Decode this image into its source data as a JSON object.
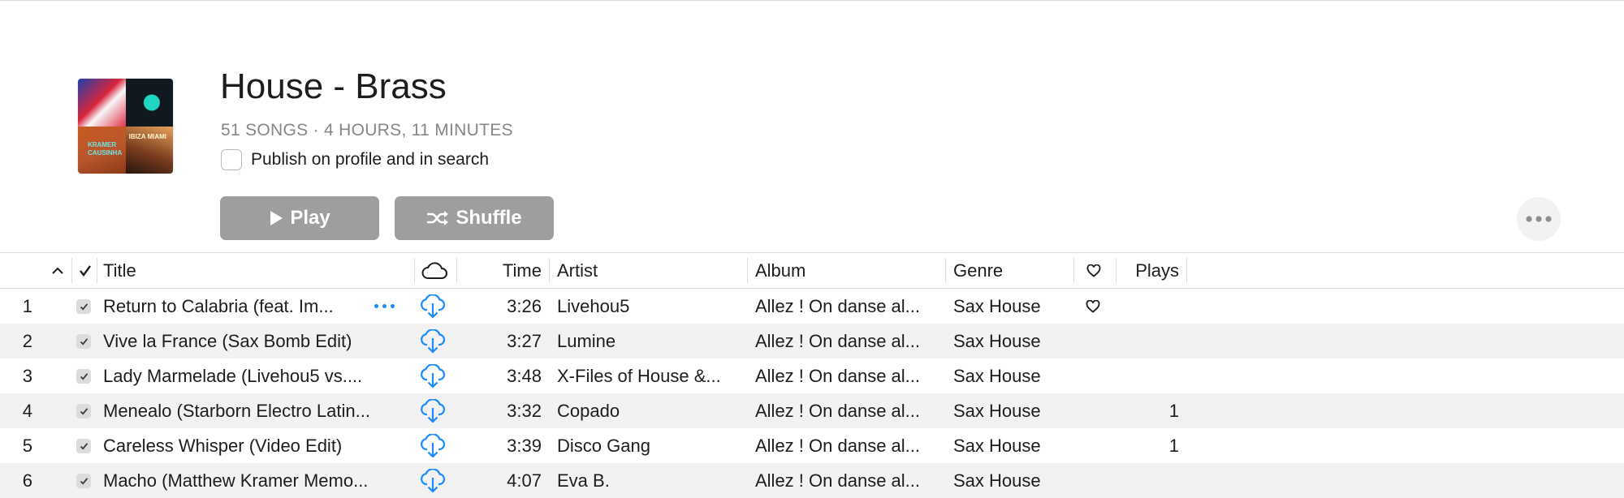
{
  "playlist": {
    "title": "House - Brass",
    "subtitle": "51 SONGS · 4 HOURS, 11 MINUTES",
    "publish_label": "Publish on profile and in search",
    "publish_checked": false,
    "artwork_text": {
      "tile3": "KRAMER CAUSINHA",
      "tile4": "IBIZA MIAMI"
    }
  },
  "buttons": {
    "play_label": "Play",
    "shuffle_label": "Shuffle",
    "color": "#9e9e9e"
  },
  "columns": {
    "sort_indicator": "^",
    "check": "✓",
    "title": "Title",
    "cloud_icon": "cloud-icon",
    "time": "Time",
    "artist": "Artist",
    "album": "Album",
    "genre": "Genre",
    "love_icon": "heart-icon",
    "plays": "Plays"
  },
  "accent_color": "#1a8cff",
  "rows": [
    {
      "num": "1",
      "title": "Return to Calabria (feat. Im...",
      "time": "3:26",
      "artist": "Livehou5",
      "album": "Allez ! On danse al...",
      "genre": "Sax House",
      "loved": true,
      "plays": ""
    },
    {
      "num": "2",
      "title": "Vive la France (Sax Bomb Edit)",
      "time": "3:27",
      "artist": "Lumine",
      "album": "Allez ! On danse al...",
      "genre": "Sax House",
      "loved": false,
      "plays": ""
    },
    {
      "num": "3",
      "title": "Lady Marmelade (Livehou5 vs....",
      "time": "3:48",
      "artist": "X-Files of House &...",
      "album": "Allez ! On danse al...",
      "genre": "Sax House",
      "loved": false,
      "plays": ""
    },
    {
      "num": "4",
      "title": "Menealo (Starborn Electro Latin...",
      "time": "3:32",
      "artist": "Copado",
      "album": "Allez ! On danse al...",
      "genre": "Sax House",
      "loved": false,
      "plays": "1"
    },
    {
      "num": "5",
      "title": "Careless Whisper (Video Edit)",
      "time": "3:39",
      "artist": "Disco Gang",
      "album": "Allez ! On danse al...",
      "genre": "Sax House",
      "loved": false,
      "plays": "1"
    },
    {
      "num": "6",
      "title": "Macho (Matthew Kramer Memo...",
      "time": "4:07",
      "artist": "Eva B.",
      "album": "Allez ! On danse al...",
      "genre": "Sax House",
      "loved": false,
      "plays": ""
    }
  ]
}
